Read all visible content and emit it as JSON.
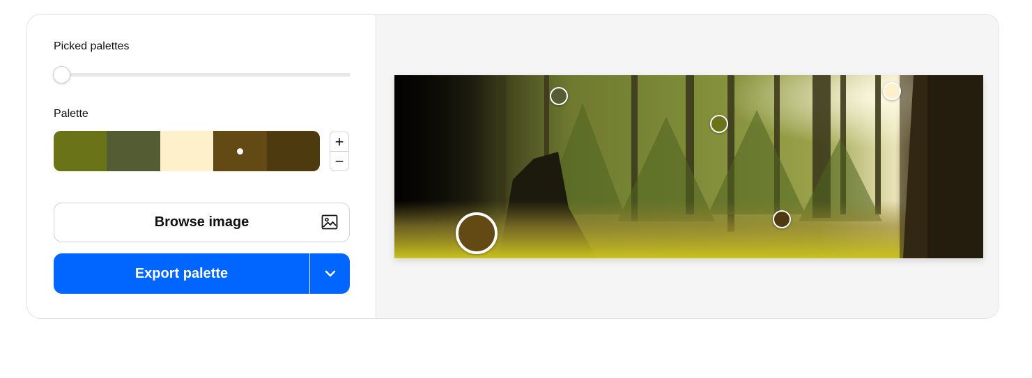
{
  "picked_palettes": {
    "label": "Picked palettes",
    "value": 0
  },
  "palette": {
    "label": "Palette",
    "colors": [
      "#6b7319",
      "#545c33",
      "#fff0cc",
      "#634914",
      "#4d3b0f"
    ],
    "selected_index": 3,
    "add_symbol": "+",
    "remove_symbol": "−"
  },
  "browse": {
    "label": "Browse image",
    "icon": "image-icon"
  },
  "export": {
    "label": "Export palette",
    "dropdown_icon": "chevron-down-icon"
  },
  "markers": [
    {
      "color": "#634914",
      "size": "large"
    },
    {
      "color": "#545c33",
      "size": "small"
    },
    {
      "color": "#6b7319",
      "size": "small"
    },
    {
      "color": "#fff0cc",
      "size": "small"
    },
    {
      "color": "#4d3b0f",
      "size": "small"
    }
  ]
}
